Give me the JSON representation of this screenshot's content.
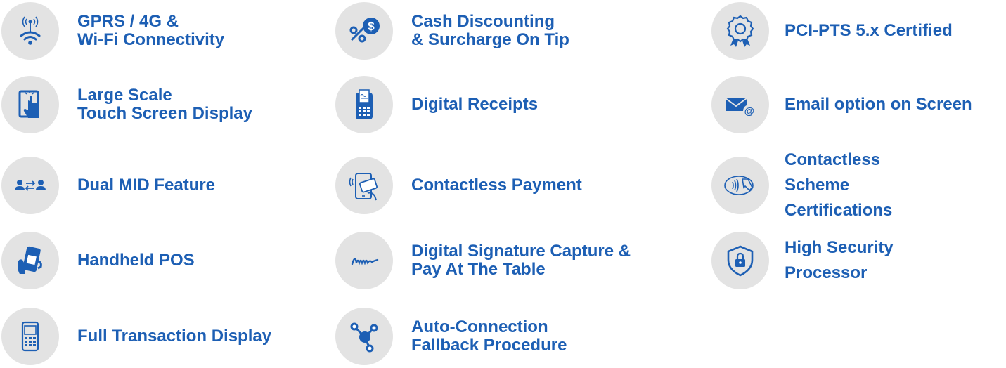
{
  "brand_color": "#1d5fb4",
  "icon_bg_color": "#e3e3e3",
  "features": [
    {
      "icon": "wifi-tower-icon",
      "lines": [
        "GPRS / 4G &",
        "Wi-Fi Connectivity"
      ]
    },
    {
      "icon": "large-touch-screen-icon",
      "lines": [
        "Large Scale",
        "Touch Screen Display"
      ]
    },
    {
      "icon": "dual-mid-users-icon",
      "lines": [
        "Dual MID Feature"
      ]
    },
    {
      "icon": "handheld-pos-icon",
      "lines": [
        "Handheld POS"
      ]
    },
    {
      "icon": "pos-terminal-icon",
      "lines": [
        "Full Transaction Display"
      ]
    },
    {
      "icon": "percent-dollar-icon",
      "lines": [
        "Cash Discounting",
        "& Surcharge On Tip"
      ]
    },
    {
      "icon": "receipt-terminal-icon",
      "lines": [
        "Digital Receipts"
      ]
    },
    {
      "icon": "contactless-phone-card-icon",
      "lines": [
        "Contactless Payment"
      ]
    },
    {
      "icon": "signature-icon",
      "lines": [
        "Digital Signature Capture &",
        "Pay At The Table"
      ]
    },
    {
      "icon": "network-nodes-icon",
      "lines": [
        "Auto-Connection",
        "Fallback Procedure"
      ]
    },
    {
      "icon": "certified-badge-icon",
      "lines": [
        "PCI-PTS 5.x Certified"
      ]
    },
    {
      "icon": "email-at-icon",
      "lines": [
        "Email option on Screen"
      ]
    },
    {
      "icon": "contactless-card-tap-icon",
      "lines": [
        "Contactless",
        "Scheme",
        "Certifications"
      ]
    },
    {
      "icon": "security-shield-lock-icon",
      "lines": [
        "High Security",
        "Processor"
      ]
    }
  ]
}
